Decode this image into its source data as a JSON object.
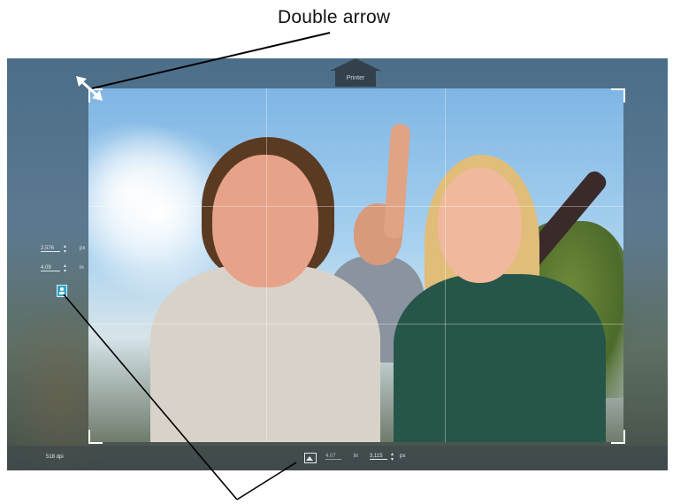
{
  "caption": {
    "text": "Double arrow"
  },
  "printer_tab": {
    "label": "Printer"
  },
  "side_panel": {
    "width_value": "2,576",
    "width_unit": "px",
    "height_value": "4.09",
    "height_unit": "in",
    "orientation_icon": "portrait-icon"
  },
  "bottom_bar": {
    "dpi_text": "518 dpi",
    "in_value": "4.07",
    "in_unit": "in",
    "px_value": "3,115",
    "px_unit": "px",
    "orientation_icon": "landscape-icon"
  },
  "colors": {
    "accent": "#33a4c9",
    "panel": "#34414c"
  }
}
